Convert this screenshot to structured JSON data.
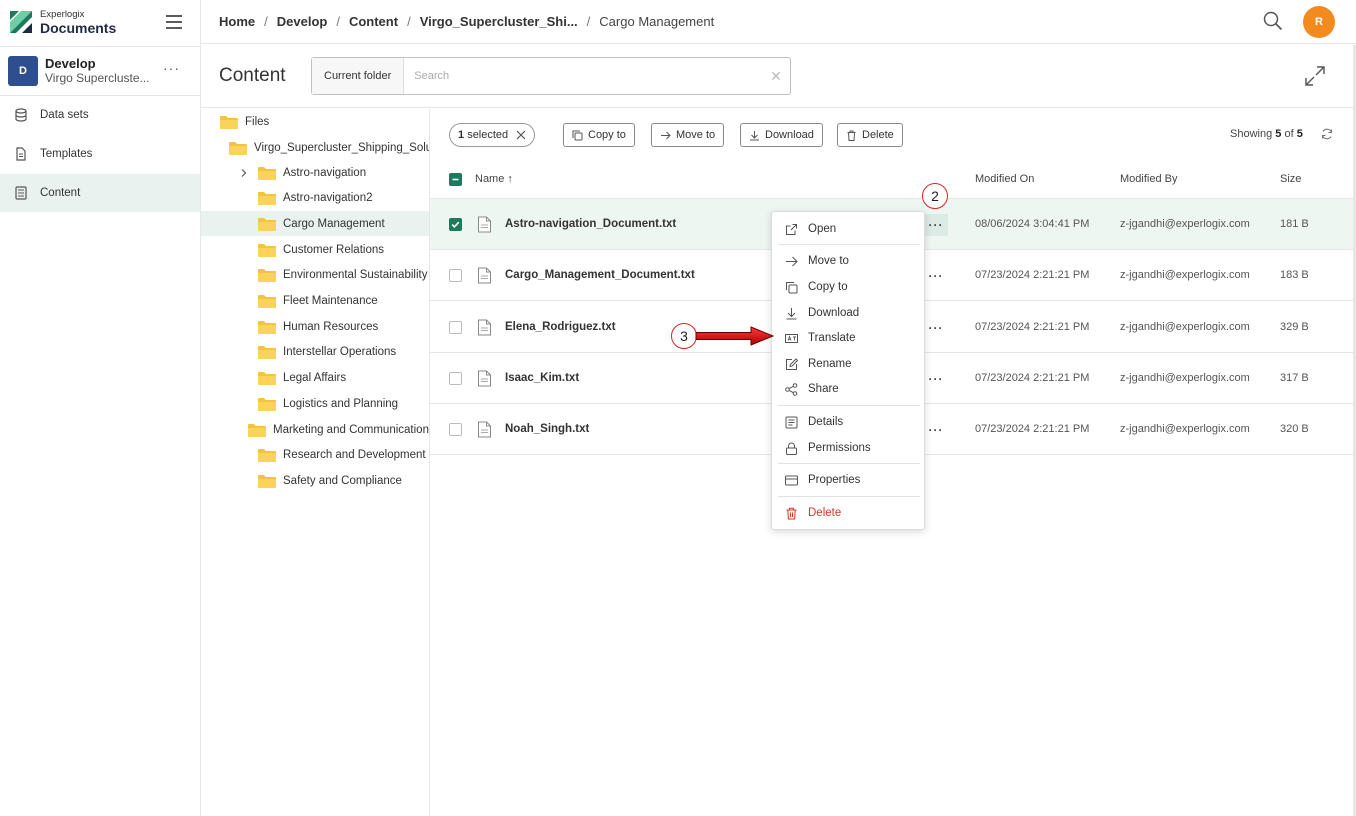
{
  "brand": {
    "small": "Experlogix",
    "big": "Documents",
    "logo_colors": [
      "#1d7a5c",
      "#6ccfa8",
      "#1f2a44"
    ]
  },
  "workspace": {
    "initial": "D",
    "name": "Develop",
    "subtitle": "Virgo Supercluste...",
    "more": "···"
  },
  "nav": [
    {
      "label": "Data sets",
      "icon": "database-icon"
    },
    {
      "label": "Templates",
      "icon": "document-icon"
    },
    {
      "label": "Content",
      "icon": "content-icon",
      "active": true
    }
  ],
  "breadcrumb": [
    "Home",
    "Develop",
    "Content",
    "Virgo_Supercluster_Shi...",
    "Cargo Management"
  ],
  "breadcrumb_sep": "/",
  "user": {
    "initial": "R",
    "color": "#f28a1e"
  },
  "content": {
    "title": "Content",
    "scope": "Current folder",
    "search_placeholder": "Search",
    "clear": "✕"
  },
  "tree": {
    "root": "Files",
    "parent": "Virgo_Supercluster_Shipping_Solutions",
    "folders": [
      {
        "label": "Astro-navigation",
        "expandable": true
      },
      {
        "label": "Astro-navigation2",
        "expandable": false
      },
      {
        "label": "Cargo Management",
        "expandable": false,
        "selected": true
      },
      {
        "label": "Customer Relations",
        "expandable": false
      },
      {
        "label": "Environmental Sustainability",
        "expandable": false
      },
      {
        "label": "Fleet Maintenance",
        "expandable": false
      },
      {
        "label": "Human Resources",
        "expandable": false
      },
      {
        "label": "Interstellar Operations",
        "expandable": false
      },
      {
        "label": "Legal Affairs",
        "expandable": false
      },
      {
        "label": "Logistics and Planning",
        "expandable": false
      },
      {
        "label": "Marketing and Communications",
        "expandable": true
      },
      {
        "label": "Research and Development",
        "expandable": false
      },
      {
        "label": "Safety and Compliance",
        "expandable": false
      }
    ]
  },
  "toolbar": {
    "selected_count": "1",
    "selected_text": "selected",
    "copy_to": "Copy to",
    "move_to": "Move to",
    "download": "Download",
    "delete": "Delete",
    "showing_prefix": "Showing",
    "showing_count": "5",
    "showing_of": "of",
    "showing_total": "5"
  },
  "table": {
    "columns": {
      "name": "Name",
      "sort": "↑",
      "modified_on": "Modified On",
      "modified_by": "Modified By",
      "size": "Size"
    },
    "rows": [
      {
        "name": "Astro-navigation_Document.txt",
        "modified_on": "08/06/2024 3:04:41 PM",
        "modified_by": "z-jgandhi@experlogix.com",
        "size": "181 B",
        "selected": true
      },
      {
        "name": "Cargo_Management_Document.txt",
        "modified_on": "07/23/2024 2:21:21 PM",
        "modified_by": "z-jgandhi@experlogix.com",
        "size": "183 B"
      },
      {
        "name": "Elena_Rodriguez.txt",
        "modified_on": "07/23/2024 2:21:21 PM",
        "modified_by": "z-jgandhi@experlogix.com",
        "size": "329 B"
      },
      {
        "name": "Isaac_Kim.txt",
        "modified_on": "07/23/2024 2:21:21 PM",
        "modified_by": "z-jgandhi@experlogix.com",
        "size": "317 B"
      },
      {
        "name": "Noah_Singh.txt",
        "modified_on": "07/23/2024 2:21:21 PM",
        "modified_by": "z-jgandhi@experlogix.com",
        "size": "320 B"
      }
    ],
    "more": "···"
  },
  "context_menu": {
    "open": "Open",
    "move_to": "Move to",
    "copy_to": "Copy to",
    "download": "Download",
    "translate": "Translate",
    "rename": "Rename",
    "share": "Share",
    "details": "Details",
    "permissions": "Permissions",
    "properties": "Properties",
    "delete": "Delete"
  },
  "annotations": {
    "step2": "2",
    "step3": "3",
    "color": "#dd2222"
  },
  "colors": {
    "accent": "#1d7a5c",
    "selected_bg": "#e9f2ef",
    "danger": "#d9342b"
  }
}
